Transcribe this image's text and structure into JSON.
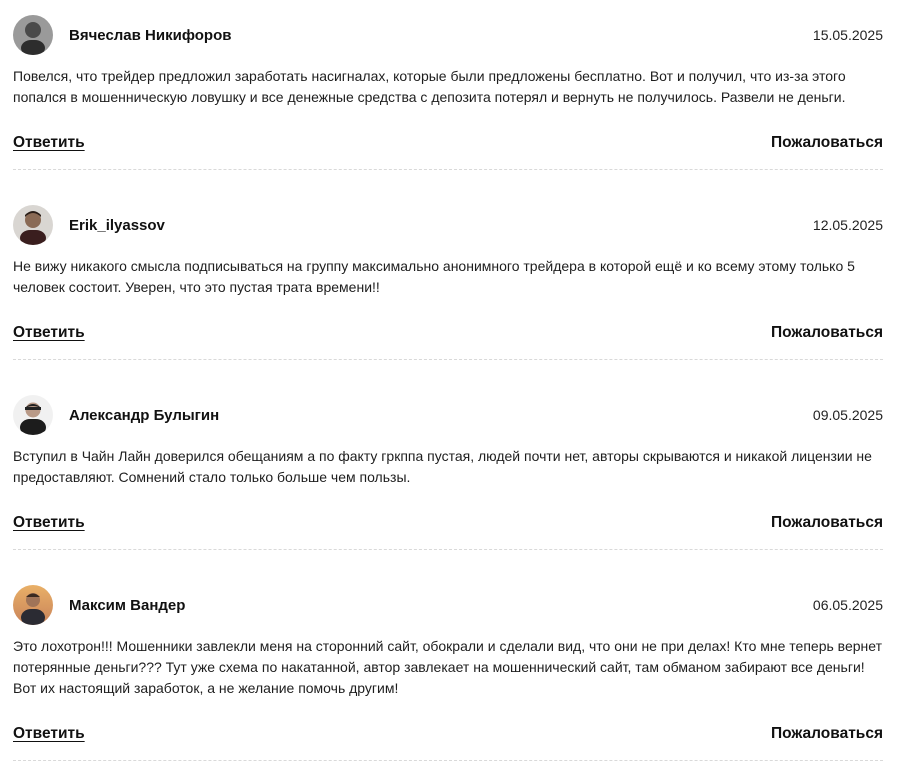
{
  "comments": [
    {
      "author": "Вячеслав Никифоров",
      "date": "15.05.2025",
      "text": "Повелся, что трейдер предложил заработать насигналах, которые были предложены бесплатно. Вот и получил, что из-за этого попался в мошенническую ловушку и все денежные средства с депозита потерял и вернуть не получилось. Развели не деньги.",
      "reply_label": "Ответить",
      "report_label": "Пожаловаться"
    },
    {
      "author": "Erik_ilyassov",
      "date": "12.05.2025",
      "text": "Не вижу никакого смысла подписываться на группу максимально анонимного трейдера в которой ещё и ко всему этому только 5 человек состоит. Уверен, что это пустая трата времени!!",
      "reply_label": "Ответить",
      "report_label": "Пожаловаться"
    },
    {
      "author": "Александр Булыгин",
      "date": "09.05.2025",
      "text": "Вступил в Чайн Лайн доверился обещаниям а по факту гркппа пустая, людей почти нет, авторы скрываются и никакой лицензии не предоставляют. Сомнений стало только больше чем пользы.",
      "reply_label": "Ответить",
      "report_label": "Пожаловаться"
    },
    {
      "author": "Максим Вандер",
      "date": "06.05.2025",
      "text": "Это лохотрон!!! Мошенники завлекли меня на сторонний сайт, обокрали и сделали вид, что они не при делах! Кто мне теперь вернет потерянные деньги??? Тут уже схема по накатанной, автор завлекает на мошеннический сайт, там обманом забирают все деньги! Вот их настоящий заработок, а не желание помочь другим!",
      "reply_label": "Ответить",
      "report_label": "Пожаловаться"
    }
  ]
}
